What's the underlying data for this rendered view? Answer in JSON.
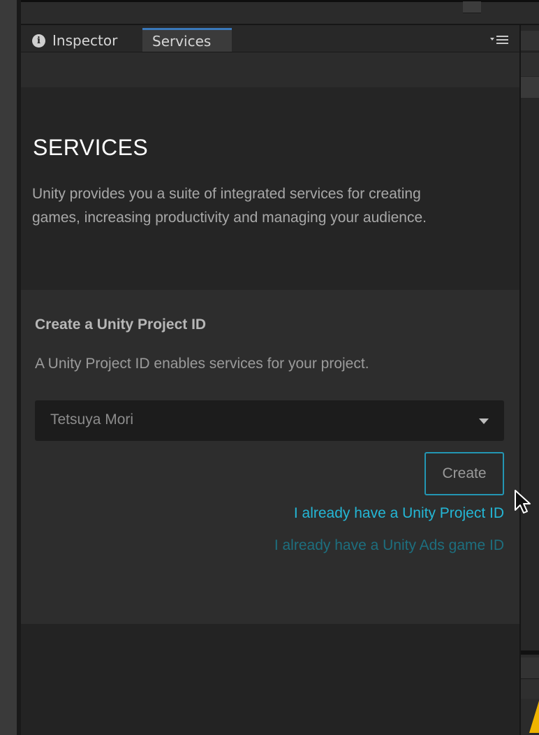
{
  "tabs": [
    {
      "label": "Inspector",
      "icon": "info-icon"
    },
    {
      "label": "Services",
      "icon": "",
      "active": true
    }
  ],
  "services": {
    "title": "SERVICES",
    "description": "Unity provides you a suite of integrated services for creating games, increasing productivity and managing your audience."
  },
  "project": {
    "title": "Create a Unity Project ID",
    "description": "A Unity Project ID enables services for your project.",
    "organization": "Tetsuya Mori",
    "create_label": "Create",
    "link_project_id": "I already have a Unity Project ID",
    "link_ads_id": "I already have a Unity Ads game ID"
  },
  "colors": {
    "accent": "#24b7d6",
    "tab_highlight": "#3a79bb",
    "warning": "#f0b400"
  }
}
